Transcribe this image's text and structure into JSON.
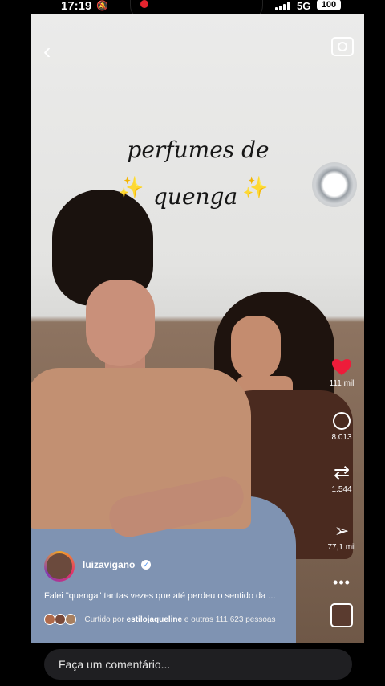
{
  "status_bar": {
    "time": "17:19",
    "network": "5G",
    "battery": "100"
  },
  "video": {
    "caption_line1": "perfumes de",
    "caption_line2": "quenga",
    "sparkle": "✨"
  },
  "top_bar": {
    "back_icon": "back-arrow-icon",
    "camera_icon": "camera-icon"
  },
  "actions": {
    "likes": "111 mil",
    "comments": "8.013",
    "reposts": "1.544",
    "shares": "77,1 mil",
    "more": "•••",
    "like_color": "#ed1c3a"
  },
  "post": {
    "username": "luizavigano",
    "verified_mark": "✓",
    "description": "Falei \"quenga\" tantas vezes que até perdeu o sentido da ...",
    "liked_prefix": "Curtido por",
    "liked_user": "estilojaqueline",
    "liked_suffix": "e outras 111.623 pessoas"
  },
  "comment": {
    "placeholder": "Faça um comentário..."
  }
}
